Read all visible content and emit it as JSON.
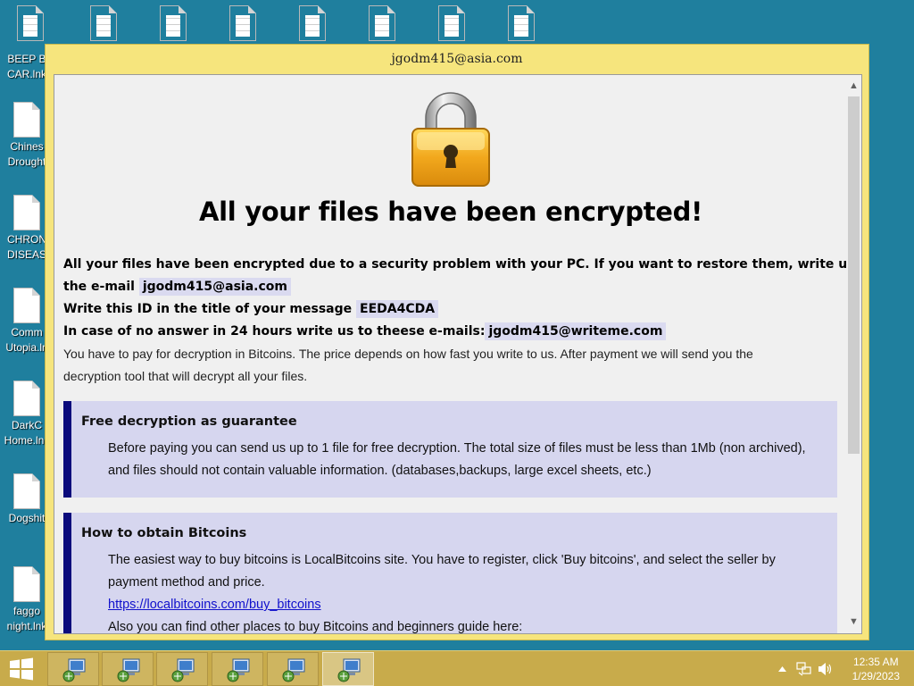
{
  "desktop": {
    "icons": [
      {
        "label": "BEEP B CAR.lnk",
        "line1": "BEEP B",
        "line2": "CAR.lnk"
      },
      {
        "label": "Chines Drought",
        "line1": "Chines",
        "line2": "Drought"
      },
      {
        "label": "CHRON DISEAS",
        "line1": "CHRON",
        "line2": "DISEAS"
      },
      {
        "label": "Comm Utopia.ln",
        "line1": "Comm",
        "line2": "Utopia.ln"
      },
      {
        "label": "DarkC Home.lnk",
        "line1": "DarkC",
        "line2": "Home.lnk"
      },
      {
        "label": "Dogshit",
        "line1": "Dogshit",
        "line2": ""
      },
      {
        "label": "faggo night.lnk",
        "line1": "faggo",
        "line2": "night.lnk"
      }
    ]
  },
  "window": {
    "title": "jgodm415@asia.com",
    "headline": "All your files have been encrypted!",
    "message": {
      "line1": "All your files have been encrypted due to a security problem with your PC. If you want to restore them, write us to",
      "line2_prefix": "the e-mail",
      "email": "jgodm415@asia.com",
      "line3_prefix": "Write this ID in the title of your message",
      "id": "EEDA4CDA",
      "line4_prefix": "In case of no answer in 24 hours write us to theese e-mails:",
      "email2": "jgodm415@writeme.com",
      "line5": "You have to pay for decryption in Bitcoins. The price depends on how fast you write to us. After payment we will send you the",
      "line6": "decryption tool that will decrypt all your files."
    },
    "box1": {
      "heading": "Free decryption as guarantee",
      "line1": "Before paying you can send us up to 1 file for free decryption. The total size of files must be less than 1Mb (non archived),",
      "line2": "and files should not contain valuable information. (databases,backups, large excel sheets, etc.)"
    },
    "box2": {
      "heading": "How to obtain Bitcoins",
      "line1": "The easiest way to buy bitcoins is LocalBitcoins site. You have to register, click 'Buy bitcoins', and select the seller by",
      "line2": "payment method and price.",
      "link": "https://localbitcoins.com/buy_bitcoins",
      "line3": "Also you can find other places to buy Bitcoins and beginners guide here:"
    }
  },
  "taskbar": {
    "time": "12:35 AM",
    "date": "1/29/2023",
    "app_count": 6,
    "accent": "#c8ab4b"
  },
  "colors": {
    "desktop": "#1f7f9e",
    "window_frame": "#f6e57d",
    "box_background": "#d6d6ef",
    "box_border": "#0c0c7c",
    "lock_gold": "#f2a81d"
  }
}
